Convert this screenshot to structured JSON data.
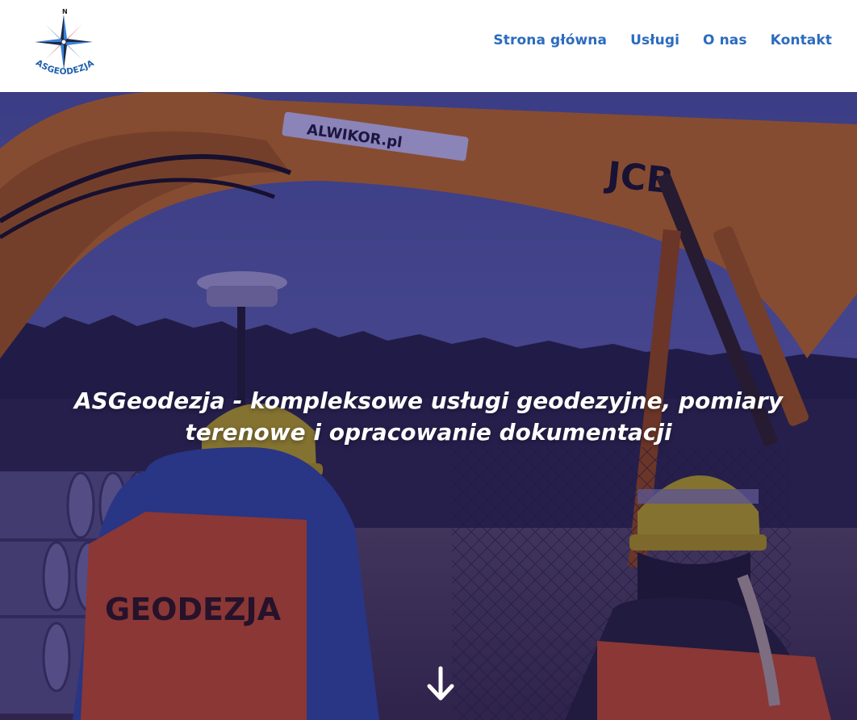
{
  "brand": {
    "logo_letter": "N",
    "logo_text": "ASGEODEZJA"
  },
  "nav": {
    "items": [
      {
        "label": "Strona główna"
      },
      {
        "label": "Usługi"
      },
      {
        "label": "O nas"
      },
      {
        "label": "Kontakt"
      }
    ]
  },
  "hero": {
    "headline": "ASGeodezja - kompleksowe usługi geodezyjne, pomiary terenowe i opracowanie dokumentacji",
    "scene_text": {
      "arm_brand": "ALWIKOR.pl",
      "machine_brand": "JCB",
      "vest_text": "GEODEZJA"
    }
  },
  "icons": {
    "logo": "compass-rose-icon",
    "scroll": "arrow-down-icon"
  },
  "colors": {
    "nav_link": "#2b6bbf",
    "logo_blue": "#1f5fae",
    "logo_red": "#d8302a",
    "hero_tint": "#34288c",
    "excavator_orange": "#e8862a",
    "vest_orange": "#f0602e",
    "helmet_yellow": "#e6cf2a"
  }
}
